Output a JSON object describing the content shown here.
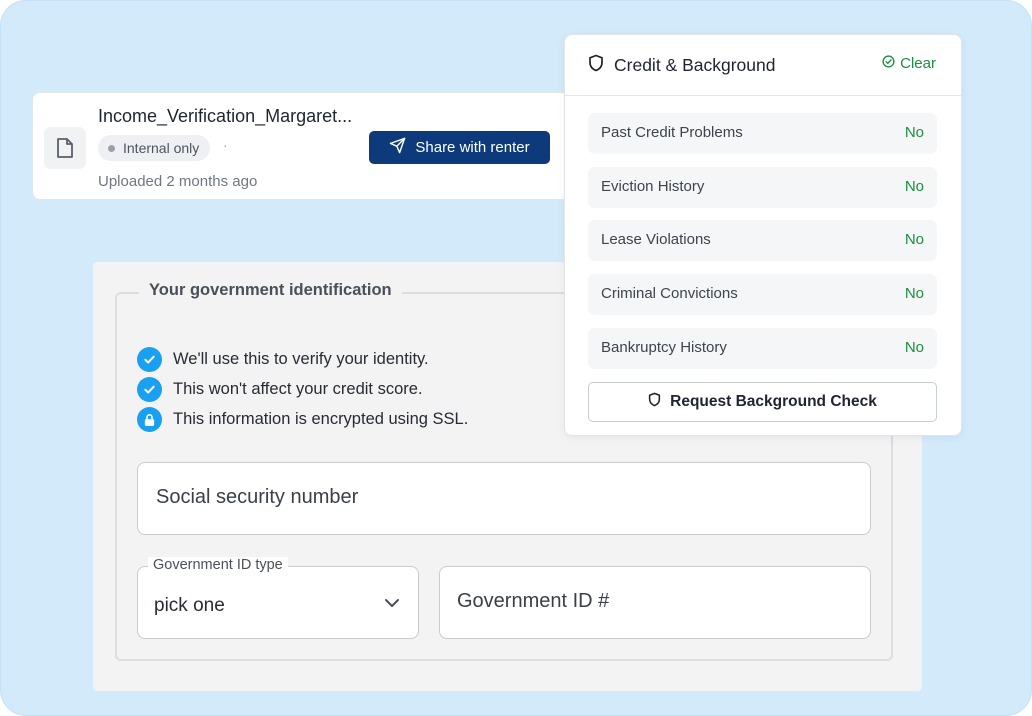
{
  "file_card": {
    "file_name": "Income_Verification_Margaret...",
    "badge": "Internal only",
    "separator": "·",
    "share_button": "Share with renter",
    "uploaded": "Uploaded 2 months ago",
    "icons": {
      "file": "document-icon",
      "share": "send-icon"
    }
  },
  "id_form": {
    "legend": "Your government identification",
    "info": [
      {
        "icon": "check-circle-icon",
        "text": "We'll use this to verify your identity."
      },
      {
        "icon": "check-circle-icon",
        "text": "This won't affect your credit score."
      },
      {
        "icon": "lock-icon",
        "text": "This information is encrypted using SSL."
      }
    ],
    "ssn_placeholder": "Social security number",
    "id_type_label": "Government ID type",
    "id_type_value": "pick one",
    "id_number_placeholder": "Government ID #"
  },
  "credit": {
    "title": "Credit & Background",
    "status": "Clear",
    "items": [
      {
        "label": "Past Credit Problems",
        "value": "No"
      },
      {
        "label": "Eviction History",
        "value": "No"
      },
      {
        "label": "Lease Violations",
        "value": "No"
      },
      {
        "label": "Criminal Convictions",
        "value": "No"
      },
      {
        "label": "Bankruptcy History",
        "value": "No"
      }
    ],
    "request_button": "Request Background Check"
  },
  "colors": {
    "background": "#d3eafb",
    "primary_button": "#0d3a7a",
    "success": "#199043",
    "info_icon": "#1aa0f0"
  }
}
